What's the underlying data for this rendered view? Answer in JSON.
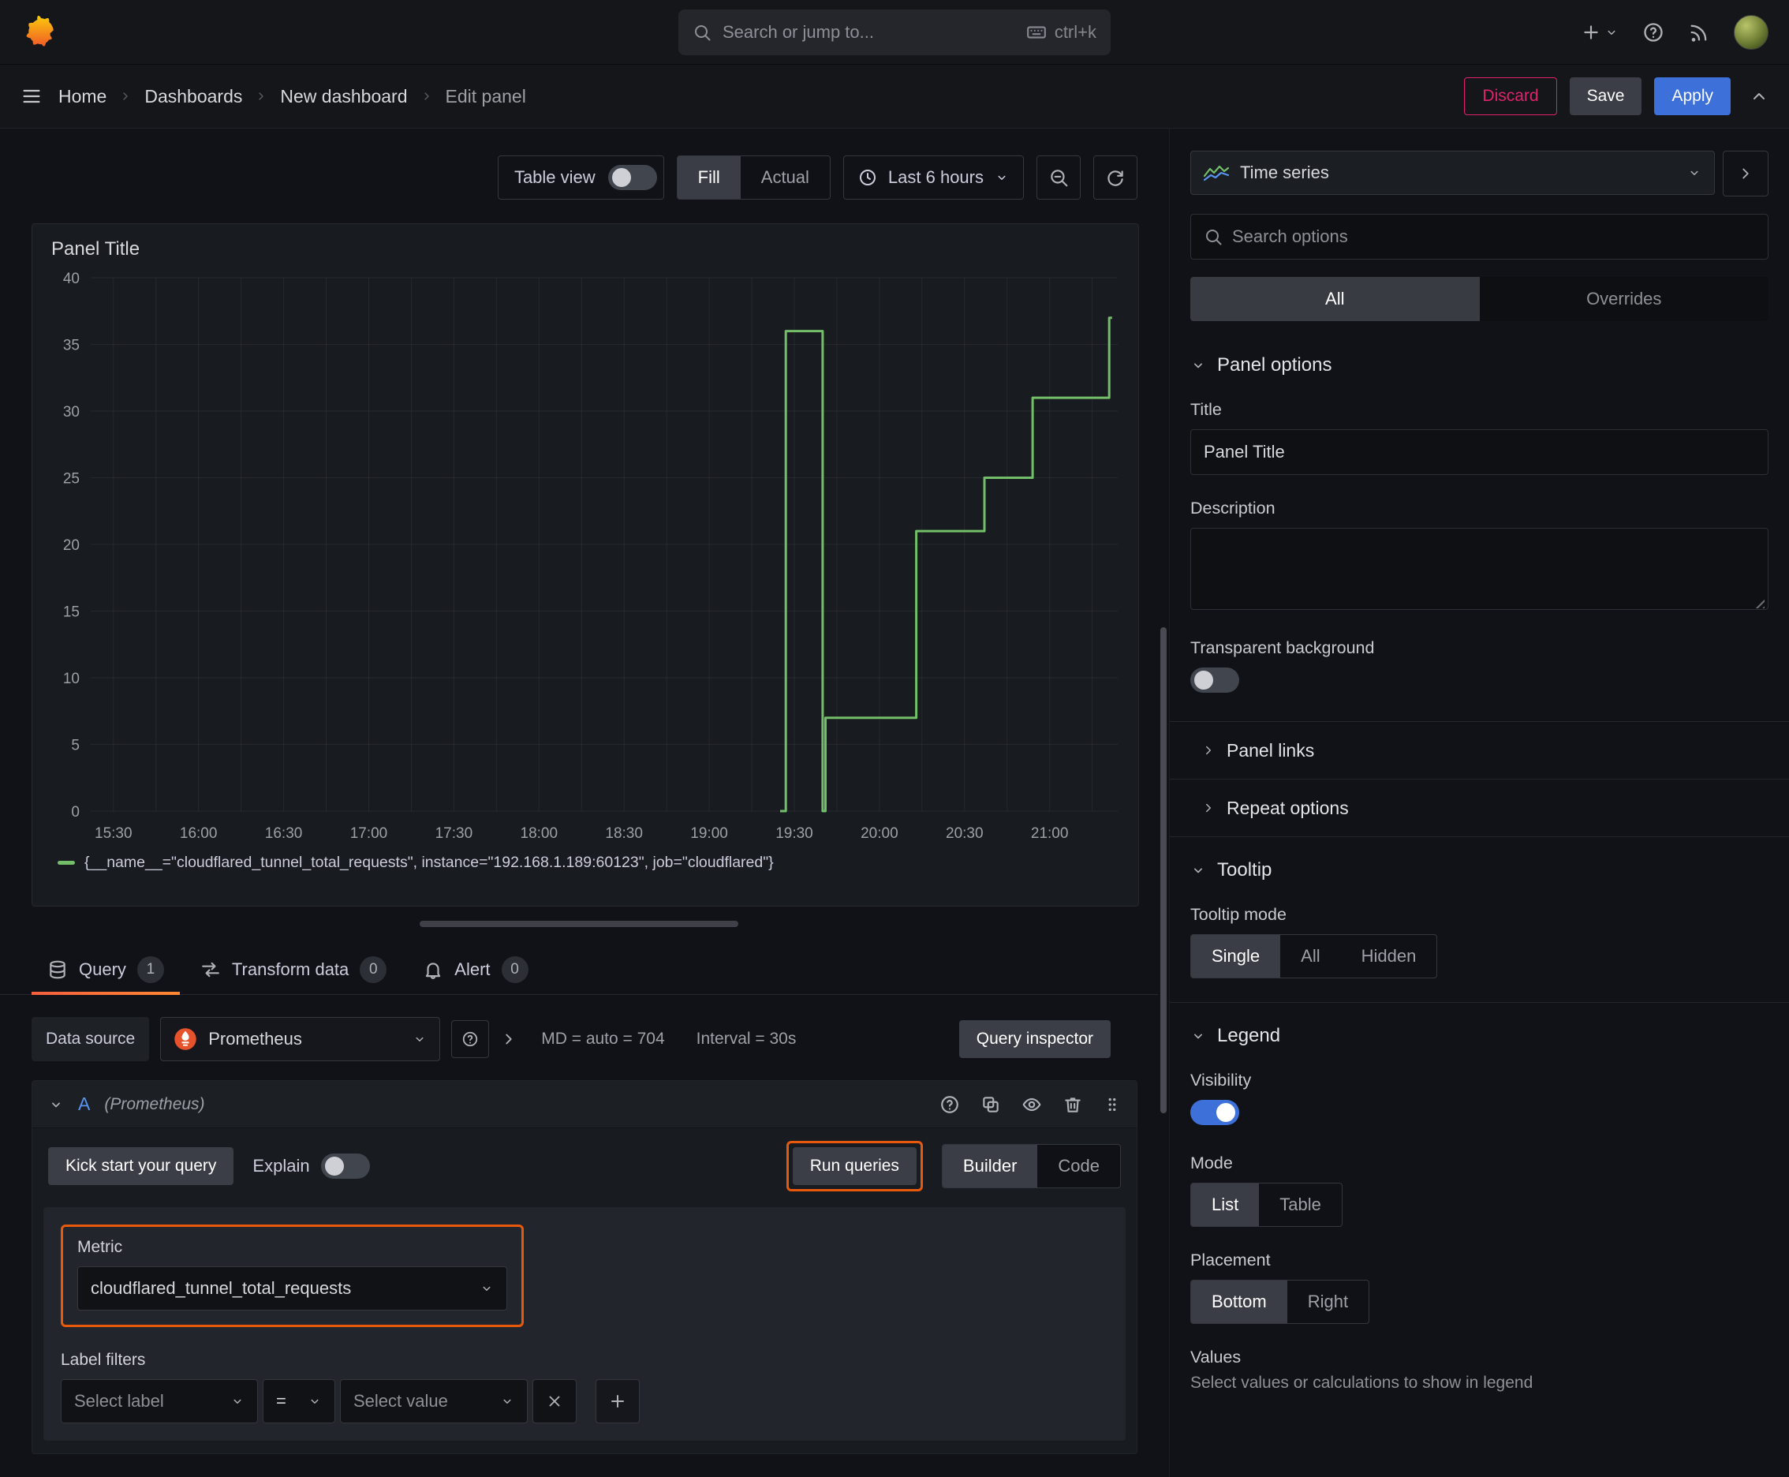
{
  "colors": {
    "primary_blue": "#3d71d9",
    "destructive_red": "#e0226e",
    "highlight_orange": "#e8590c",
    "accent_orange": "#ff8833",
    "toggle_on_blue": "#3d71d9",
    "refid_blue": "#5794f2",
    "series_green": "#73bf69",
    "prometheus_orange": "#e6522c"
  },
  "topbar": {
    "search_placeholder": "Search or jump to...",
    "shortcut": "ctrl+k"
  },
  "breadcrumb": {
    "items": [
      "Home",
      "Dashboards",
      "New dashboard",
      "Edit panel"
    ],
    "discard": "Discard",
    "save": "Save",
    "apply": "Apply"
  },
  "toolbar": {
    "table_view": "Table view",
    "fill": "Fill",
    "actual": "Actual",
    "time_range": "Last 6 hours"
  },
  "panel": {
    "title": "Panel Title",
    "legend": "{__name__=\"cloudflared_tunnel_total_requests\", instance=\"192.168.1.189:60123\", job=\"cloudflared\"}"
  },
  "chart_data": {
    "type": "line",
    "title": "Panel Title",
    "xlabel": "",
    "ylabel": "",
    "ylim": [
      0,
      40
    ],
    "y_ticks": [
      0,
      5,
      10,
      15,
      20,
      25,
      30,
      35,
      40
    ],
    "x_ticks": [
      "15:30",
      "16:00",
      "16:30",
      "17:00",
      "17:30",
      "18:00",
      "18:30",
      "19:00",
      "19:30",
      "20:00",
      "20:30",
      "21:00"
    ],
    "x_range": [
      "15:22",
      "21:24"
    ],
    "grid": true,
    "legend_position": "bottom",
    "series": [
      {
        "name": "{__name__=\"cloudflared_tunnel_total_requests\", instance=\"192.168.1.189:60123\", job=\"cloudflared\"}",
        "color": "#73bf69",
        "step": true,
        "points": [
          {
            "x": "19:25",
            "y": 0
          },
          {
            "x": "19:27",
            "y": 36
          },
          {
            "x": "19:39",
            "y": 36
          },
          {
            "x": "19:40",
            "y": 0
          },
          {
            "x": "19:41",
            "y": 7
          },
          {
            "x": "20:12",
            "y": 7
          },
          {
            "x": "20:13",
            "y": 21
          },
          {
            "x": "20:36",
            "y": 21
          },
          {
            "x": "20:37",
            "y": 25
          },
          {
            "x": "20:53",
            "y": 25
          },
          {
            "x": "20:54",
            "y": 31
          },
          {
            "x": "21:20",
            "y": 31
          },
          {
            "x": "21:21",
            "y": 37
          },
          {
            "x": "21:22",
            "y": 37
          }
        ]
      }
    ]
  },
  "tabs": {
    "query": "Query",
    "query_count": "1",
    "transform": "Transform data",
    "transform_count": "0",
    "alert": "Alert",
    "alert_count": "0"
  },
  "query": {
    "datasource_label": "Data source",
    "datasource": "Prometheus",
    "stat_md": "MD = auto = 704",
    "stat_interval": "Interval = 30s",
    "inspector": "Query inspector",
    "ref_id": "A",
    "ref_ds": "(Prometheus)",
    "kickstart": "Kick start your query",
    "explain": "Explain",
    "run": "Run queries",
    "builder": "Builder",
    "code": "Code",
    "metric_label": "Metric",
    "metric_value": "cloudflared_tunnel_total_requests",
    "label_filters": "Label filters",
    "select_label": "Select label",
    "op": "=",
    "select_value": "Select value"
  },
  "options": {
    "viz": "Time series",
    "search_placeholder": "Search options",
    "tab_all": "All",
    "tab_overrides": "Overrides",
    "panel_options": "Panel options",
    "title_label": "Title",
    "title_value": "Panel Title",
    "description_label": "Description",
    "transparent": "Transparent background",
    "panel_links": "Panel links",
    "repeat_options": "Repeat options",
    "tooltip": "Tooltip",
    "tooltip_mode": "Tooltip mode",
    "tooltip_single": "Single",
    "tooltip_all": "All",
    "tooltip_hidden": "Hidden",
    "legend": "Legend",
    "visibility": "Visibility",
    "mode": "Mode",
    "mode_list": "List",
    "mode_table": "Table",
    "placement": "Placement",
    "placement_bottom": "Bottom",
    "placement_right": "Right",
    "values": "Values",
    "values_help": "Select values or calculations to show in legend"
  }
}
